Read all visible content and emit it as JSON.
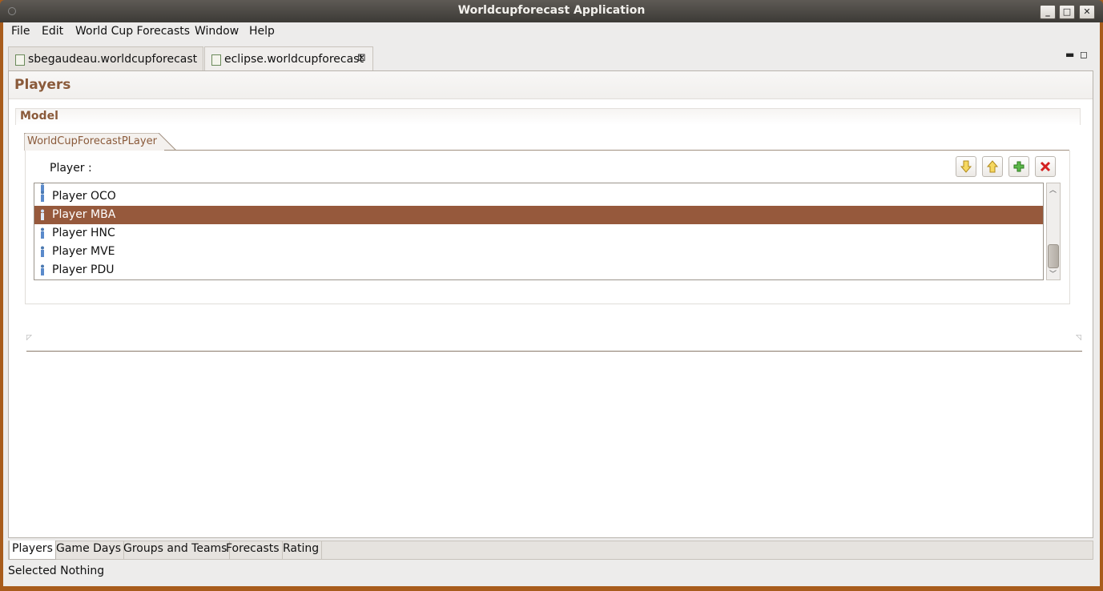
{
  "window": {
    "title": "Worldcupforecast Application"
  },
  "menu": [
    {
      "label": "File"
    },
    {
      "label": "Edit"
    },
    {
      "label": "World Cup Forecasts"
    },
    {
      "label": "Window"
    },
    {
      "label": "Help"
    }
  ],
  "editor_tabs": [
    {
      "label": "sbegaudeau.worldcupforecast",
      "icon": "file-icon",
      "active": false
    },
    {
      "label": "eclipse.worldcupforecast",
      "icon": "file-icon",
      "active": true,
      "close": "⊠"
    }
  ],
  "form": {
    "title": "Players",
    "section": "Model",
    "subtab": "WorldCupForecastPLayer",
    "player_label": "Player :",
    "toolbar": {
      "down_icon": "arrow-down-icon",
      "up_icon": "arrow-up-icon",
      "add_icon": "plus-icon",
      "delete_icon": "delete-icon"
    },
    "players": [
      {
        "label": "Player OCO",
        "selected": false
      },
      {
        "label": "Player MBA",
        "selected": true
      },
      {
        "label": "Player HNC",
        "selected": false
      },
      {
        "label": "Player MVE",
        "selected": false
      },
      {
        "label": "Player PDU",
        "selected": false
      }
    ]
  },
  "bottom_tabs": [
    {
      "label": "Players",
      "active": true
    },
    {
      "label": "Game Days",
      "active": false
    },
    {
      "label": "Groups and Teams",
      "active": false
    },
    {
      "label": "Forecasts",
      "active": false
    },
    {
      "label": "Rating",
      "active": false
    }
  ],
  "status": "Selected Nothing",
  "colors": {
    "accent": "#96593c",
    "title_text": "#8a5a3a",
    "frame": "#a85c1c"
  }
}
